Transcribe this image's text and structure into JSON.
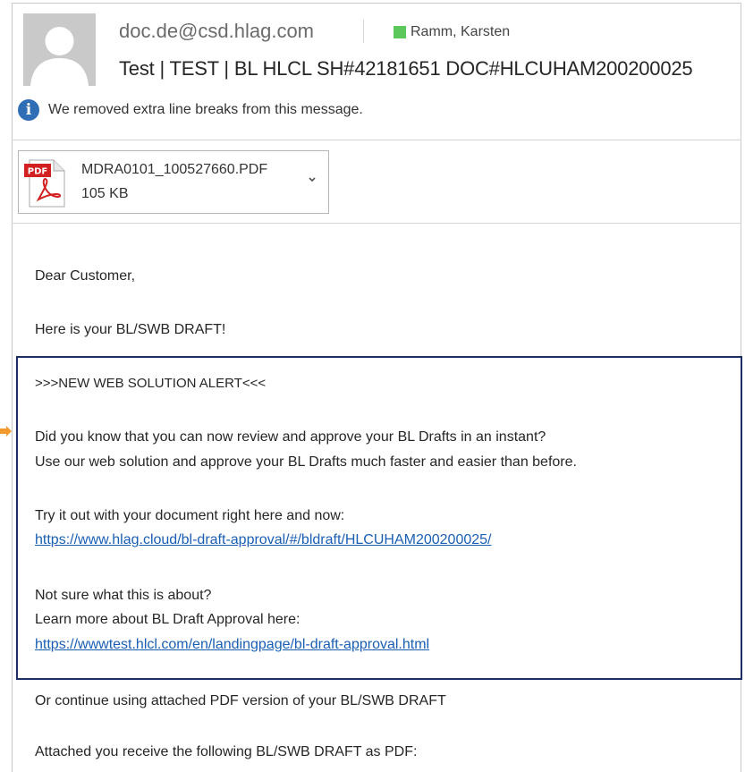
{
  "header": {
    "sender": "doc.de@csd.hlag.com",
    "recipient": "Ramm, Karsten",
    "subject": "Test | TEST | BL HLCL SH#42181651 DOC#HLCUHAM200200025",
    "presence_color": "#5cc85c"
  },
  "info_bar": {
    "icon": "info-icon",
    "text": "We removed extra line breaks from this message."
  },
  "attachment": {
    "icon": "pdf-icon",
    "badge": "PDF",
    "name": "MDRA0101_100527660.PDF",
    "size": "105 KB"
  },
  "body": {
    "greeting": "Dear Customer,",
    "intro": "Here is your BL/SWB DRAFT!",
    "alert": {
      "heading": ">>>NEW WEB SOLUTION ALERT<<<",
      "line1": "Did you know that you can now review and approve your BL Drafts in an instant?",
      "line2": "Use our web solution and approve your BL Drafts much faster and easier than before.",
      "try_text": "Try it out with your document right here and now:",
      "try_link": "https://www.hlag.cloud/bl-draft-approval/#/bldraft/HLCUHAM200200025/",
      "not_sure": "Not sure what this is about?",
      "learn_more": "Learn more about BL Draft Approval here:",
      "learn_link": "https://wwwtest.hlcl.com/en/landingpage/bl-draft-approval.html",
      "border_color": "#1c2d64"
    },
    "continue_text": "Or continue using attached PDF version of your BL/SWB DRAFT",
    "attached_text": "Attached you receive the following BL/SWB DRAFT as PDF:",
    "link_color": "#1a5fb4"
  }
}
